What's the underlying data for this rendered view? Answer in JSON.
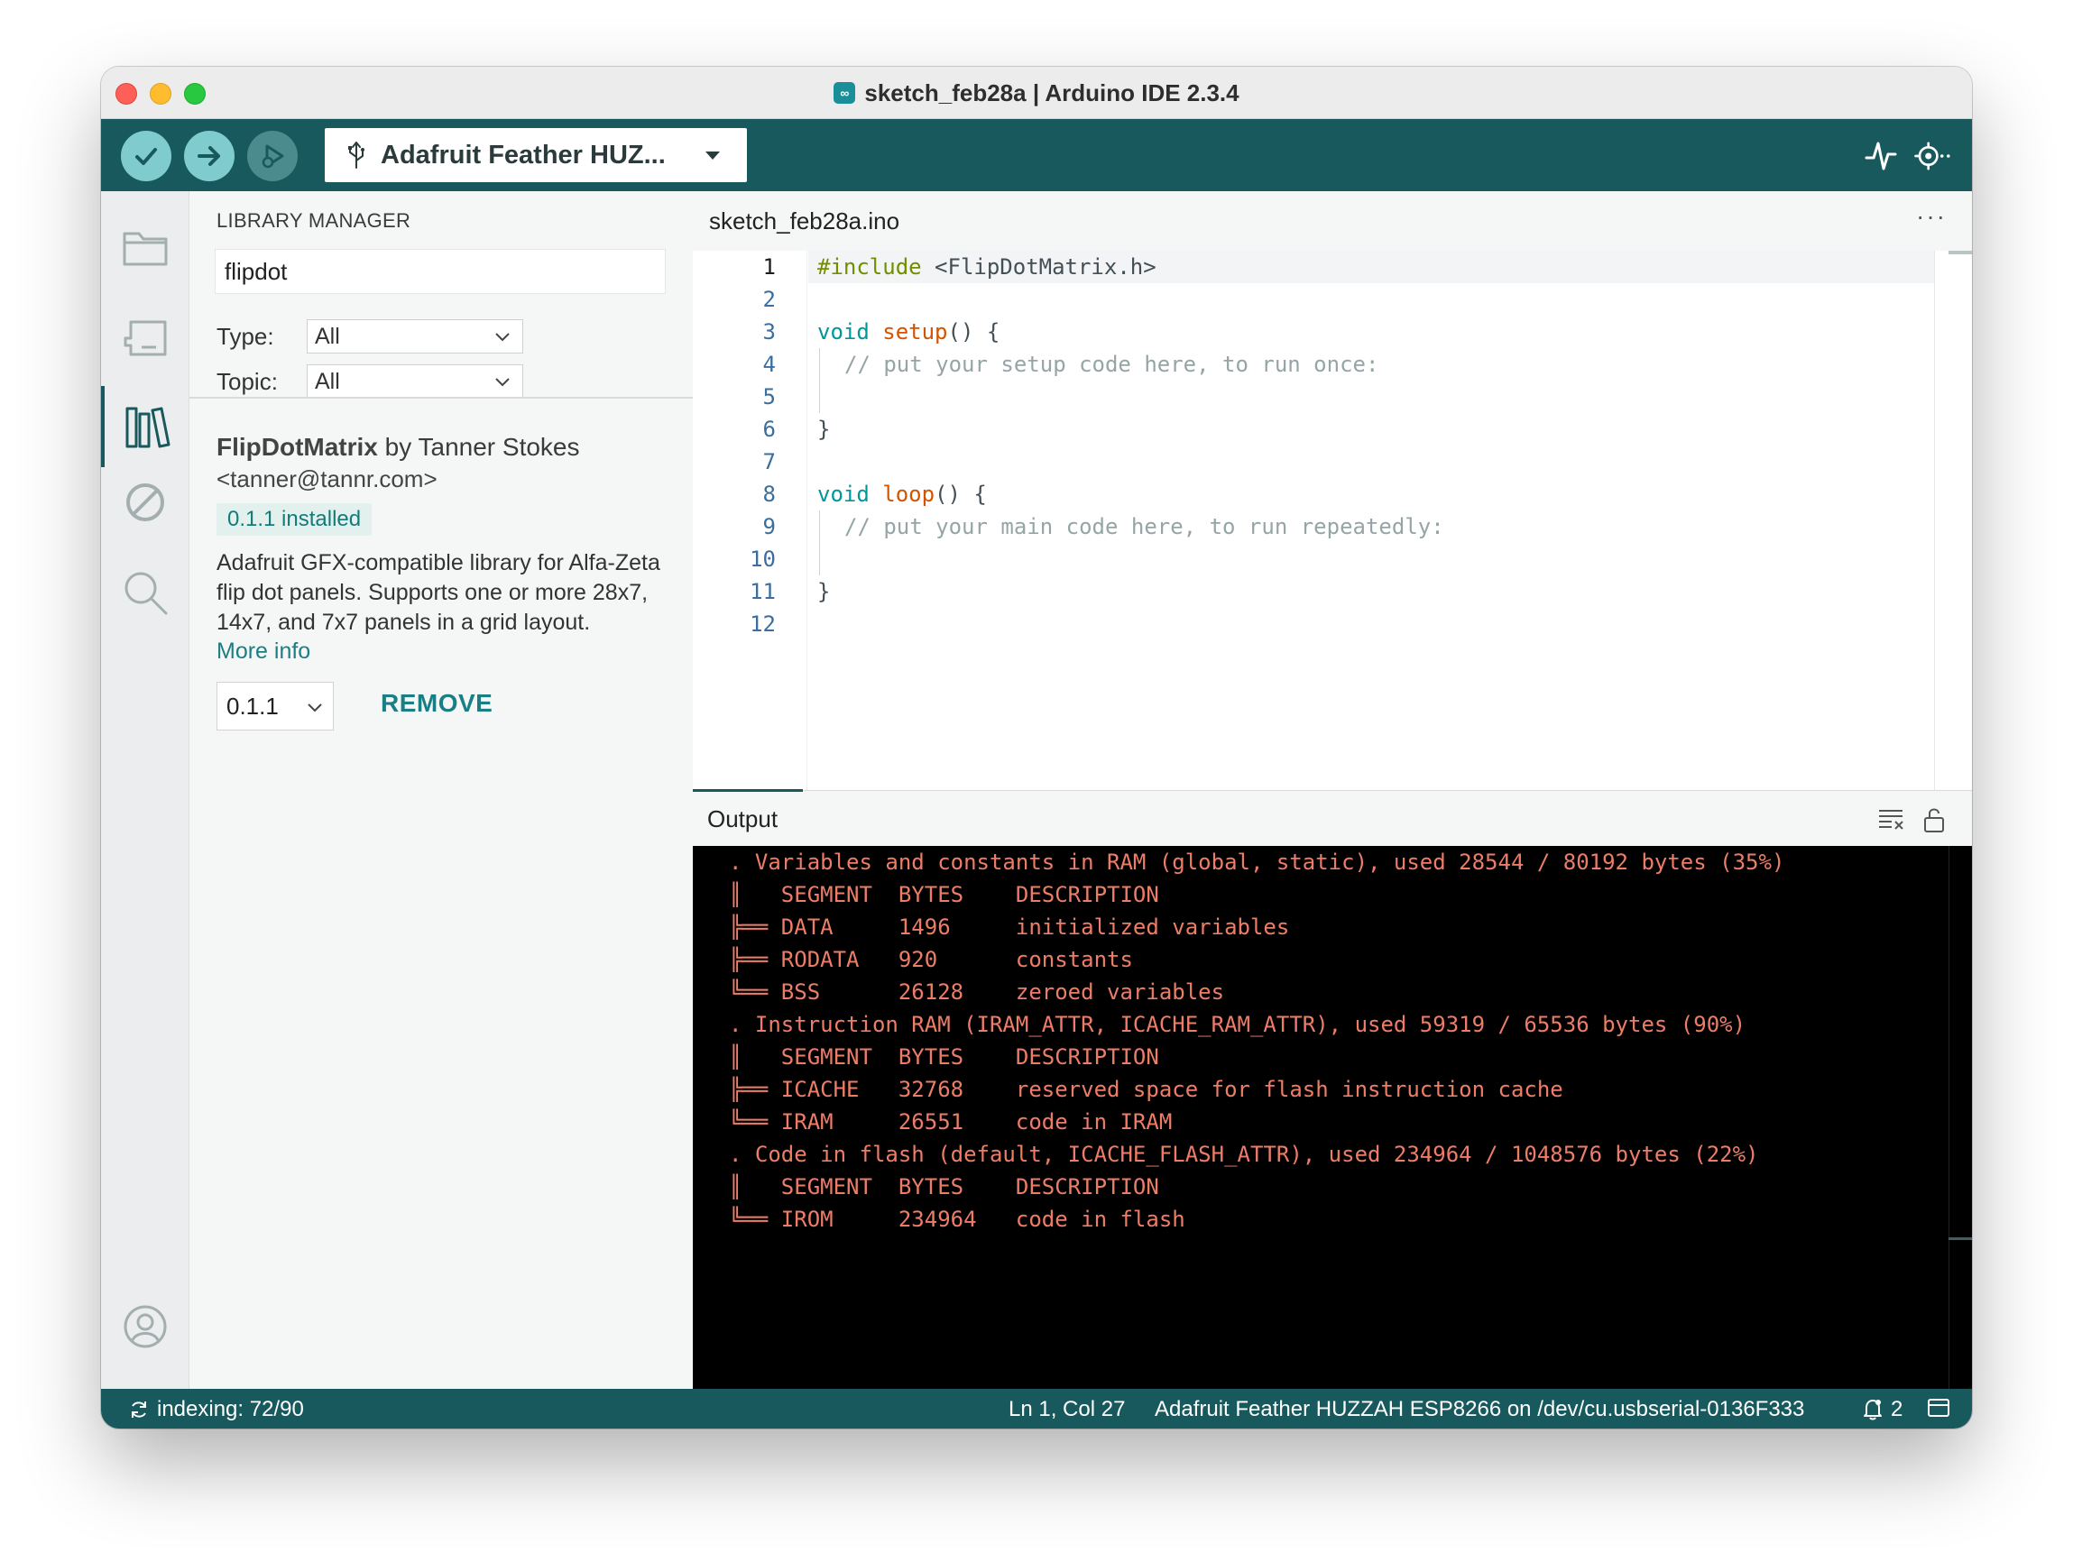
{
  "window": {
    "title": "sketch_feb28a | Arduino IDE 2.3.4",
    "app_icon": "arduino-logo-icon",
    "app_icon_glyph": "∞"
  },
  "toolbar": {
    "verify_icon": "check-icon",
    "upload_icon": "arrow-right-icon",
    "debug_icon": "debug-icon",
    "board_icon": "usb-icon",
    "board_label": "Adafruit Feather HUZ...",
    "serial_plotter_icon": "serial-plotter-icon",
    "serial_monitor_icon": "serial-monitor-icon"
  },
  "activity_bar": {
    "items": [
      {
        "name": "sketchbook",
        "icon": "folder-icon"
      },
      {
        "name": "boards-manager",
        "icon": "board-icon"
      },
      {
        "name": "library-manager",
        "icon": "library-icon",
        "active": true
      },
      {
        "name": "debug",
        "icon": "no-debug-icon"
      },
      {
        "name": "search",
        "icon": "search-icon"
      }
    ],
    "account_icon": "account-icon"
  },
  "library_manager": {
    "header": "LIBRARY MANAGER",
    "search_value": "flipdot",
    "type_label": "Type:",
    "type_value": "All",
    "topic_label": "Topic:",
    "topic_value": "All",
    "library": {
      "name": "FlipDotMatrix",
      "by": " by Tanner Stokes",
      "email": "<tanner@tannr.com>",
      "installed_badge": "0.1.1 installed",
      "description": "Adafruit GFX-compatible library for Alfa-Zeta flip dot panels. Supports one or more 28x7, 14x7, and 7x7 panels in a grid layout.",
      "more_info": "More info",
      "version": "0.1.1",
      "remove_label": "REMOVE"
    }
  },
  "editor": {
    "tab_label": "sketch_feb28a.ino",
    "more_label": "···",
    "line_numbers": [
      "1",
      "2",
      "3",
      "4",
      "5",
      "6",
      "7",
      "8",
      "9",
      "10",
      "11",
      "12"
    ],
    "lines": {
      "l1_inc": "#include",
      "l1_rest": " <FlipDotMatrix.h>",
      "l3_type": "void",
      "l3_fn": "setup",
      "l3_rest": "() {",
      "l4_comment": "// put your setup code here, to run once:",
      "l6": "}",
      "l8_type": "void",
      "l8_fn": "loop",
      "l8_rest": "() {",
      "l9_comment": "// put your main code here, to run repeatedly:",
      "l11": "}"
    }
  },
  "output": {
    "title": "Output",
    "clear_icon": "clear-output-icon",
    "lock_icon": "lock-open-icon",
    "lines": [
      ". Variables and constants in RAM (global, static), used 28544 / 80192 bytes (35%)",
      "║   SEGMENT  BYTES    DESCRIPTION",
      "╠══ DATA     1496     initialized variables",
      "╠══ RODATA   920      constants",
      "╚══ BSS      26128    zeroed variables",
      ". Instruction RAM (IRAM_ATTR, ICACHE_RAM_ATTR), used 59319 / 65536 bytes (90%)",
      "║   SEGMENT  BYTES    DESCRIPTION",
      "╠══ ICACHE   32768    reserved space for flash instruction cache",
      "╚══ IRAM     26551    code in IRAM",
      ". Code in flash (default, ICACHE_FLASH_ATTR), used 234964 / 1048576 bytes (22%)",
      "║   SEGMENT  BYTES    DESCRIPTION",
      "╚══ IROM     234964   code in flash"
    ]
  },
  "status_bar": {
    "sync_icon": "sync-icon",
    "indexing": "indexing: 72/90",
    "cursor": "Ln 1, Col 27",
    "board_port": "Adafruit Feather HUZZAH ESP8266 on /dev/cu.usbserial-0136F333",
    "notifications_icon": "bell-icon",
    "notifications_count": "2",
    "panel_icon": "panel-toggle-icon"
  },
  "colors": {
    "teal_dark": "#17595d",
    "teal_light": "#7fcbcd",
    "output_text": "#ee7d68",
    "link": "#1a7f85"
  }
}
